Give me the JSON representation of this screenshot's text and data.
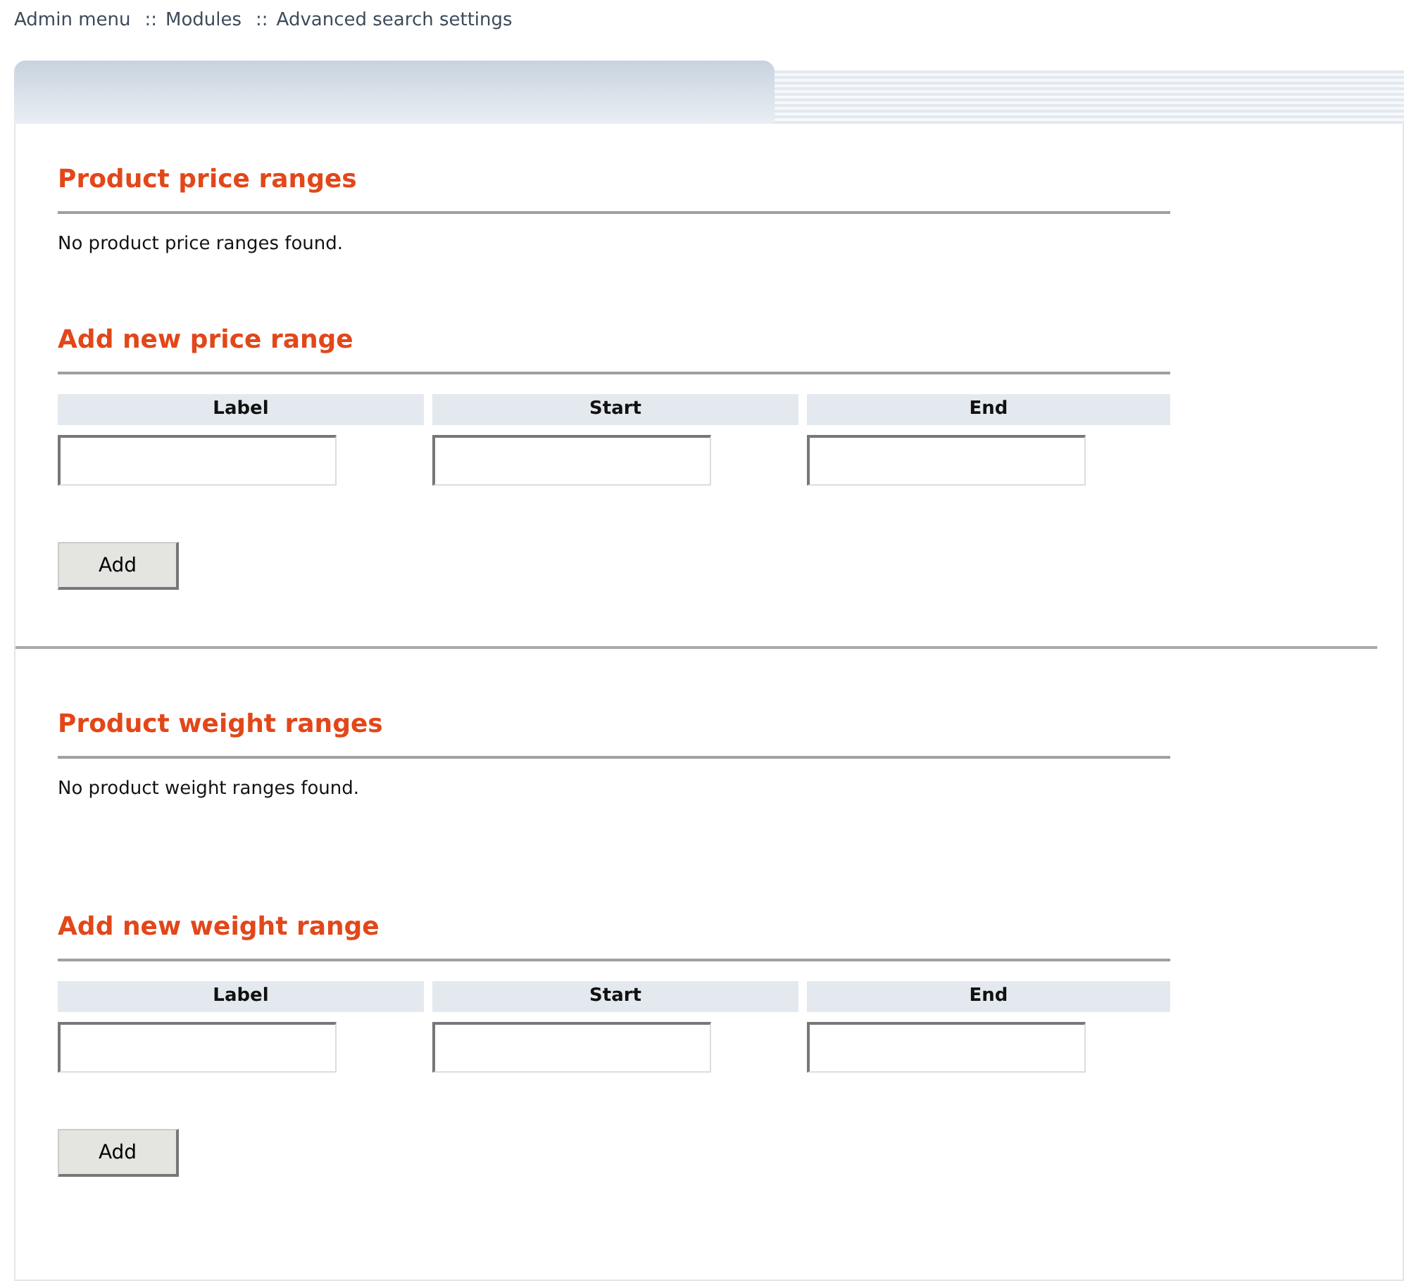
{
  "breadcrumb": {
    "separator": "::",
    "items": [
      "Admin menu",
      "Modules",
      "Advanced search settings"
    ]
  },
  "groups": [
    {
      "ranges_heading": "Product price ranges",
      "empty_message": "No product price ranges found.",
      "form_heading": "Add new price range",
      "columns": [
        "Label",
        "Start",
        "End"
      ],
      "button": "Add"
    },
    {
      "ranges_heading": "Product weight ranges",
      "empty_message": "No product weight ranges found.",
      "form_heading": "Add new weight range",
      "columns": [
        "Label",
        "Start",
        "End"
      ],
      "button": "Add"
    }
  ]
}
